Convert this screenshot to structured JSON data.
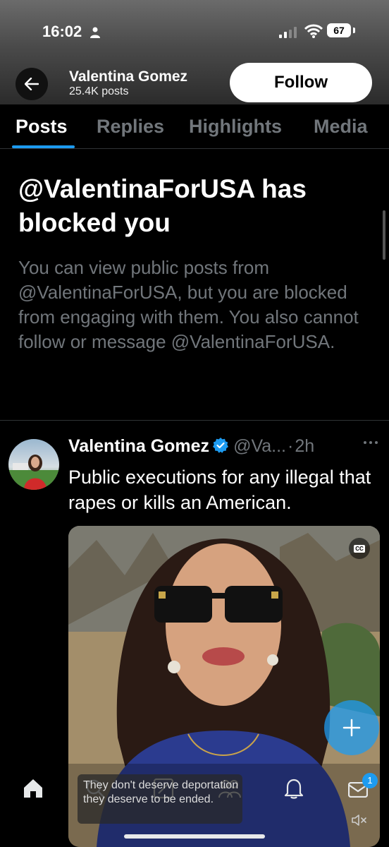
{
  "status_bar": {
    "time": "16:02",
    "battery": "67"
  },
  "profile": {
    "name": "Valentina Gomez",
    "posts": "25.4K posts",
    "follow_label": "Follow"
  },
  "tabs": [
    {
      "label": "Posts",
      "active": true
    },
    {
      "label": "Replies",
      "active": false
    },
    {
      "label": "Highlights",
      "active": false
    },
    {
      "label": "Media",
      "active": false
    }
  ],
  "blocked": {
    "title": "@ValentinaForUSA has blocked you",
    "description": "You can view public posts from @ValentinaForUSA, but you are blocked from engaging with them. You also cannot follow or message @ValentinaForUSA."
  },
  "tweet": {
    "author": "Valentina Gomez",
    "handle": "@Va...",
    "separator": "·",
    "time": "2h",
    "text": "Public executions for any illegal that rapes or kills an American.",
    "caption": "They don't deserve deportation they deserve to be ended.",
    "cc_label": "CC"
  },
  "nav": {
    "messages_badge": "1"
  },
  "colors": {
    "accent": "#1d9bf0",
    "background": "#000000",
    "muted_text": "#71767b"
  }
}
